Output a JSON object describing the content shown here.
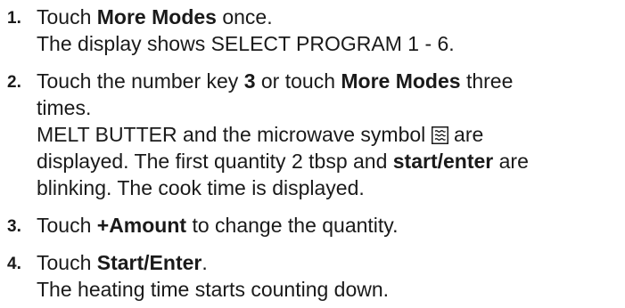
{
  "steps": [
    {
      "number": "1.",
      "instruction": {
        "pre": "Touch ",
        "bold": "More Modes",
        "post": " once."
      },
      "result": "The display shows SELECT PROGRAM 1 - 6."
    },
    {
      "number": "2.",
      "instruction": {
        "pre": "Touch the number key ",
        "bold1": "3",
        "mid": " or touch ",
        "bold2": "More Modes",
        "post_line1": " three",
        "line2": "times."
      },
      "result": {
        "line1_pre": "MELT BUTTER and the microwave symbol ",
        "icon": "microwave-symbol-icon",
        "line1_post": " are",
        "line2_pre": "displayed. The first quantity 2 tbsp and ",
        "line2_bold": "start/enter",
        "line2_post": " are",
        "line3": "blinking. The cook time is displayed."
      }
    },
    {
      "number": "3.",
      "instruction": {
        "pre": "Touch ",
        "bold": "+Amount",
        "post": " to change the quantity."
      }
    },
    {
      "number": "4.",
      "instruction": {
        "pre": "Touch ",
        "bold": "Start/Enter",
        "post": "."
      },
      "result": "The heating time starts counting down."
    }
  ]
}
